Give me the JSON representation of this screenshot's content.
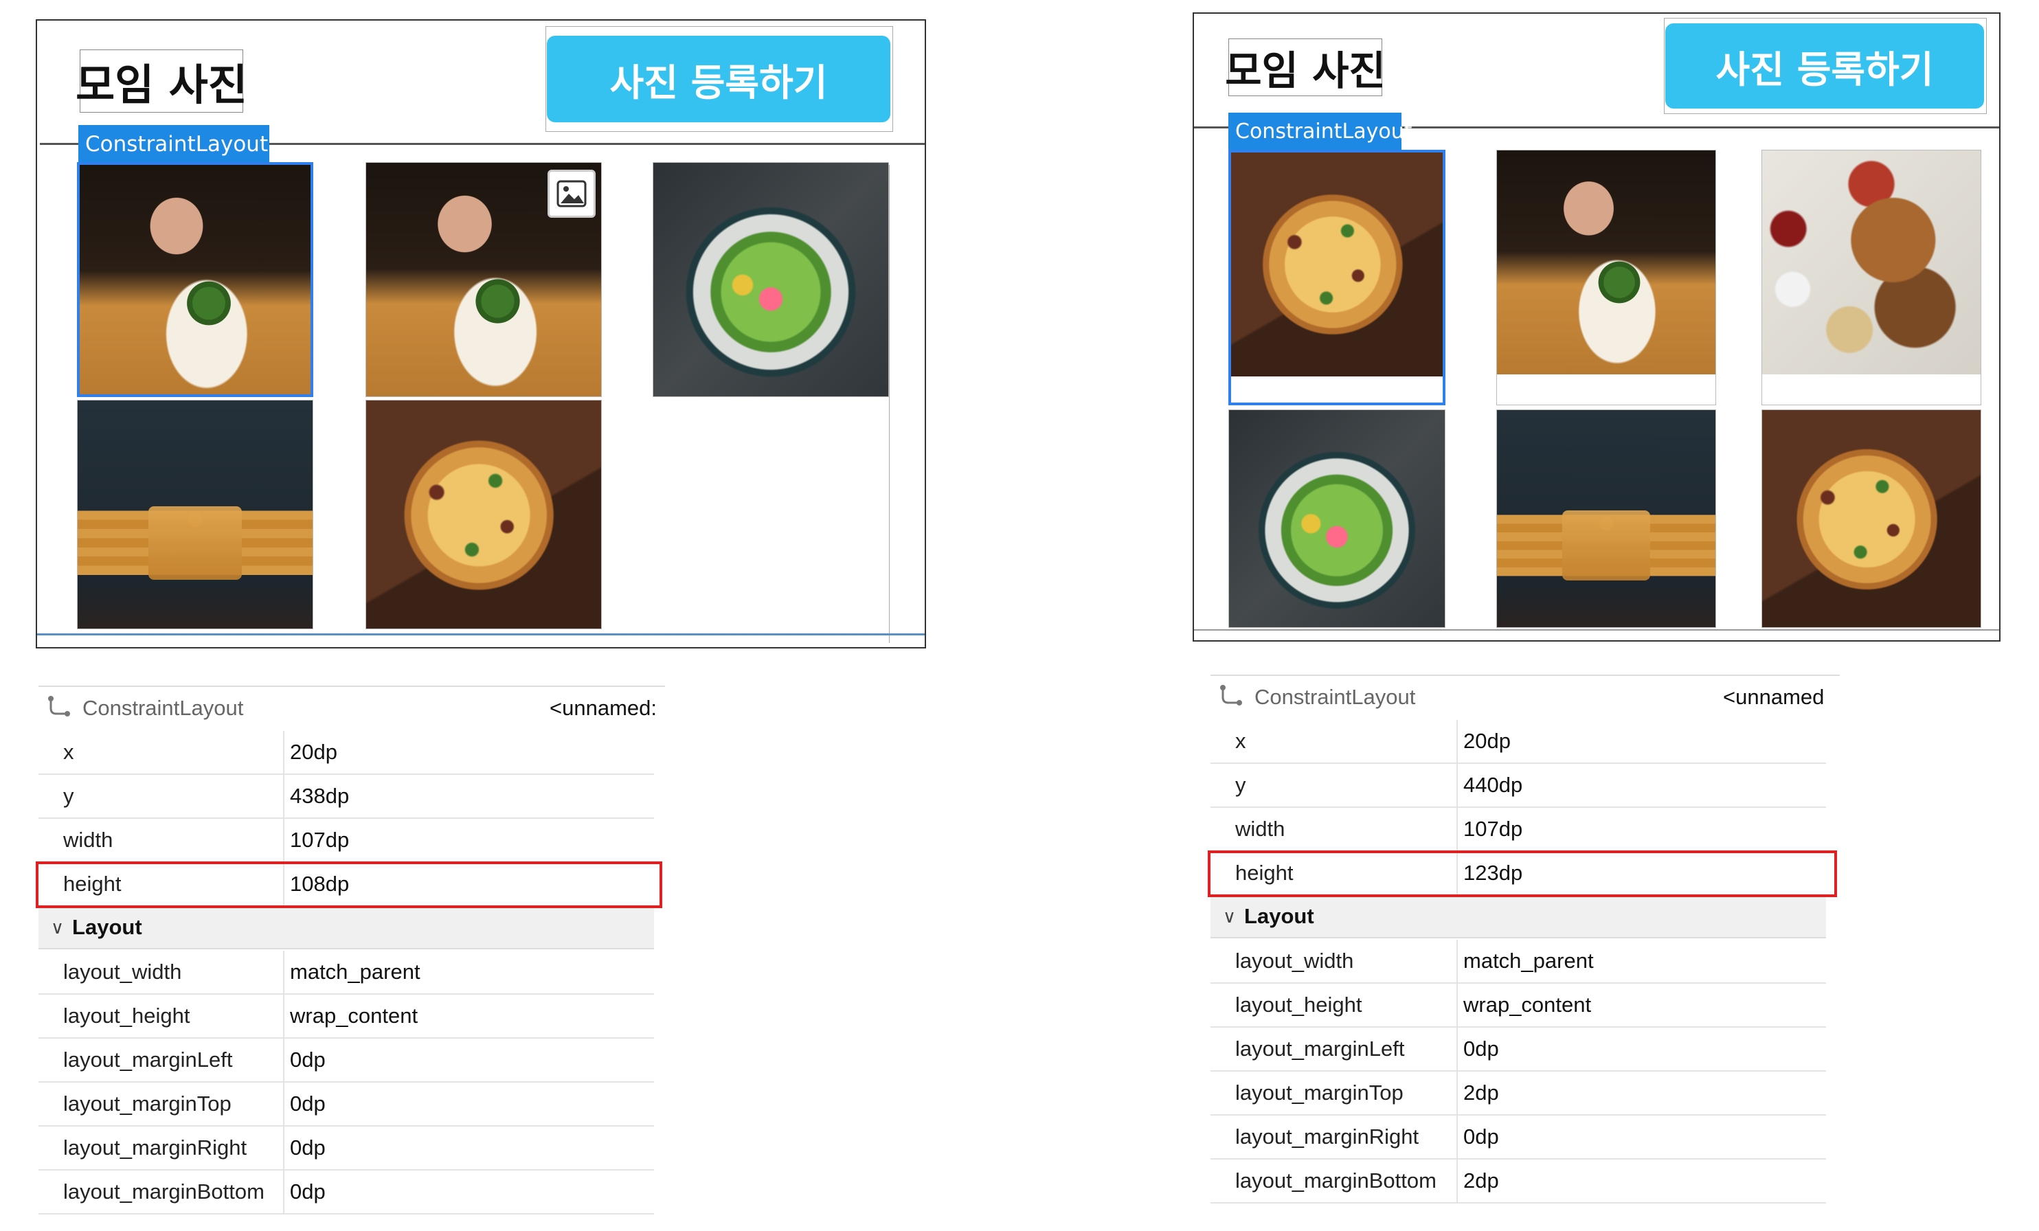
{
  "left": {
    "title": "모임 사진",
    "button_label": "사진 등록하기",
    "container_tag": "ConstraintLayout",
    "grid": [
      {
        "name": "photo-chef-plating",
        "food": "chef"
      },
      {
        "name": "photo-chef-plating",
        "food": "chef"
      },
      {
        "name": "photo-salad-bowl",
        "food": "bowl"
      },
      {
        "name": "photo-pancake-stack",
        "food": "pancake"
      },
      {
        "name": "photo-pizza",
        "food": "pizza"
      }
    ],
    "props": {
      "header_type": "ConstraintLayout",
      "header_id": "<unnamed:",
      "rows": [
        {
          "key": "x",
          "value": "20dp"
        },
        {
          "key": "y",
          "value": "438dp"
        },
        {
          "key": "width",
          "value": "107dp"
        },
        {
          "key": "height",
          "value": "108dp"
        }
      ],
      "section": "Layout",
      "layout_rows": [
        {
          "key": "layout_width",
          "value": "match_parent"
        },
        {
          "key": "layout_height",
          "value": "wrap_content"
        },
        {
          "key": "layout_marginLeft",
          "value": "0dp"
        },
        {
          "key": "layout_marginTop",
          "value": "0dp"
        },
        {
          "key": "layout_marginRight",
          "value": "0dp"
        },
        {
          "key": "layout_marginBottom",
          "value": "0dp"
        }
      ]
    }
  },
  "right": {
    "title": "모임 사진",
    "button_label": "사진 등록하기",
    "container_tag": "ConstraintLayout",
    "grid": [
      {
        "name": "photo-pizza",
        "food": "pizza"
      },
      {
        "name": "photo-chef-plating",
        "food": "chef"
      },
      {
        "name": "photo-kebab",
        "food": "kebab"
      },
      {
        "name": "photo-salad-bowl",
        "food": "bowl"
      },
      {
        "name": "photo-pancake-stack",
        "food": "pancake"
      },
      {
        "name": "photo-pizza",
        "food": "pizza"
      }
    ],
    "props": {
      "header_type": "ConstraintLayout",
      "header_id": "<unnamed",
      "rows": [
        {
          "key": "x",
          "value": "20dp"
        },
        {
          "key": "y",
          "value": "440dp"
        },
        {
          "key": "width",
          "value": "107dp"
        },
        {
          "key": "height",
          "value": "123dp"
        }
      ],
      "section": "Layout",
      "layout_rows": [
        {
          "key": "layout_width",
          "value": "match_parent"
        },
        {
          "key": "layout_height",
          "value": "wrap_content"
        },
        {
          "key": "layout_marginLeft",
          "value": "0dp"
        },
        {
          "key": "layout_marginTop",
          "value": "2dp"
        },
        {
          "key": "layout_marginRight",
          "value": "0dp"
        },
        {
          "key": "layout_marginBottom",
          "value": "2dp"
        }
      ]
    }
  },
  "icons": {
    "tree_node": "constraint-layout-icon",
    "image_placeholder": "image-placeholder-icon",
    "chevron": "chevron-down-icon"
  },
  "colors": {
    "accent_button": "#35c2f0",
    "selection": "#2f80ed",
    "highlight": "#e02020"
  }
}
